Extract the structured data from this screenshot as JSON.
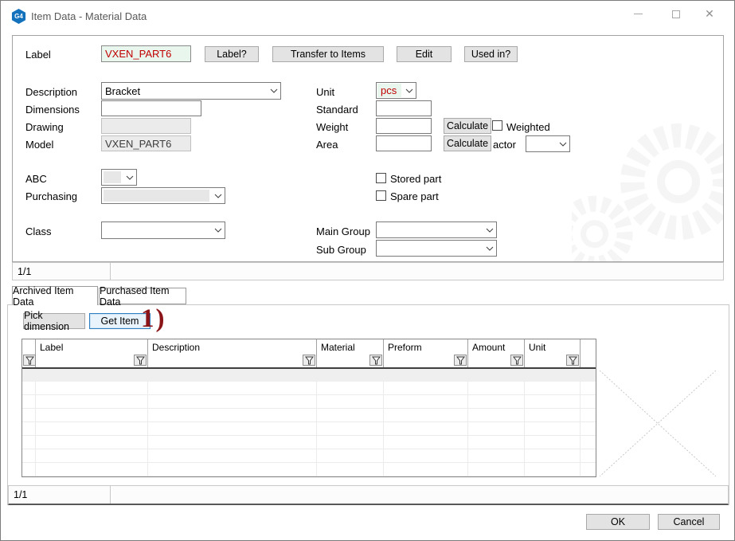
{
  "window": {
    "title": "Item Data - Material Data",
    "app_badge": "G4"
  },
  "icons": {
    "app-icon": "G4 hexagon badge",
    "minimize-icon": "–",
    "maximize-icon": "□",
    "close-icon": "✕",
    "chevron-down-icon": "⌄",
    "filter-funnel-icon": "⧩"
  },
  "colors": {
    "value_red": "#c00000",
    "field_green": "#e9f6ee",
    "annotation_red": "#8a1417",
    "focus_blue": "#2d7dc1"
  },
  "form": {
    "label": {
      "label": "Label",
      "value": "VXEN_PART6"
    },
    "buttons": {
      "label_q": "Label?",
      "transfer": "Transfer to Items",
      "edit": "Edit",
      "used_in": "Used in?"
    },
    "description": {
      "label": "Description",
      "value": "Bracket"
    },
    "unit": {
      "label": "Unit",
      "value": "pcs"
    },
    "dimensions": {
      "label": "Dimensions",
      "value": ""
    },
    "standard": {
      "label": "Standard",
      "value": ""
    },
    "drawing": {
      "label": "Drawing",
      "value": ""
    },
    "weight": {
      "label": "Weight",
      "value": "",
      "calculate": "Calculate",
      "weighted": "Weighted"
    },
    "model": {
      "label": "Model",
      "value": "VXEN_PART6"
    },
    "area": {
      "label": "Area",
      "value": "",
      "calculate": "Calculate",
      "factor_label": "actor"
    },
    "abc": {
      "label": "ABC",
      "value": ""
    },
    "purchasing": {
      "label": "Purchasing",
      "value": ""
    },
    "stored_part": "Stored part",
    "spare_part": "Spare part",
    "class": {
      "label": "Class",
      "value": ""
    },
    "main_group": {
      "label": "Main Group",
      "value": ""
    },
    "sub_group": {
      "label": "Sub Group",
      "value": ""
    },
    "record_status": "1/1"
  },
  "tabs": [
    {
      "label": "Archived Item Data",
      "active": true
    },
    {
      "label": "Purchased Item Data",
      "active": false
    }
  ],
  "toolbar": {
    "pick_dimension": "Pick dimension",
    "get_item": "Get Item"
  },
  "annotation": "1)",
  "table": {
    "columns": [
      "Label",
      "Description",
      "Material",
      "Preform",
      "Amount",
      "Unit"
    ],
    "rows": []
  },
  "bottom_status": "1/1",
  "footer": {
    "ok": "OK",
    "cancel": "Cancel"
  }
}
